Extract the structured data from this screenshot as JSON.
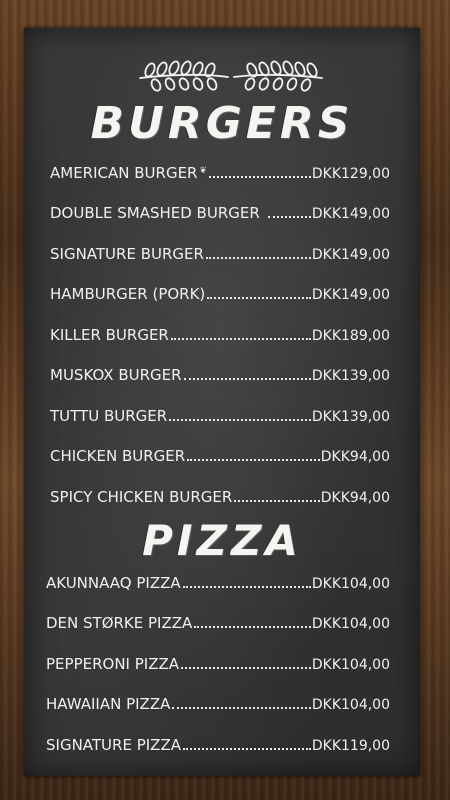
{
  "sections": {
    "burgers": {
      "title": "BURGERS",
      "items": [
        {
          "name": "AMERICAN BURGER",
          "price": "DKK129,00"
        },
        {
          "name": "DOUBLE SMASHED BURGER",
          "price": "DKK149,00"
        },
        {
          "name": "SIGNATURE BURGER",
          "price": "DKK149,00"
        },
        {
          "name": "HAMBURGER (PORK)",
          "price": "DKK149,00"
        },
        {
          "name": "KILLER BURGER",
          "price": "DKK189,00"
        },
        {
          "name": "MUSKOX BURGER",
          "price": "DKK139,00"
        },
        {
          "name": "TUTTU BURGER",
          "price": "DKK139,00"
        },
        {
          "name": "CHICKEN BURGER",
          "price": "DKK94,00"
        },
        {
          "name": "SPICY CHICKEN BURGER",
          "price": "DKK94,00"
        }
      ]
    },
    "pizza": {
      "title": "PIZZA",
      "items": [
        {
          "name": "AKUNNAAQ PIZZA",
          "price": "DKK104,00"
        },
        {
          "name": "DEN STØRKE PIZZA",
          "price": "DKK104,00"
        },
        {
          "name": "PEPPERONI PIZZA",
          "price": "DKK104,00"
        },
        {
          "name": "HAWAIIAN PIZZA",
          "price": "DKK104,00"
        },
        {
          "name": "SIGNATURE PIZZA",
          "price": "DKK119,00"
        }
      ]
    }
  },
  "icons": {
    "header": "laurel-branches-icon",
    "american_burger": "leaf-icon"
  },
  "colors": {
    "board": "#333333",
    "frame": "#5a3b22",
    "text": "#f0f0ec"
  }
}
